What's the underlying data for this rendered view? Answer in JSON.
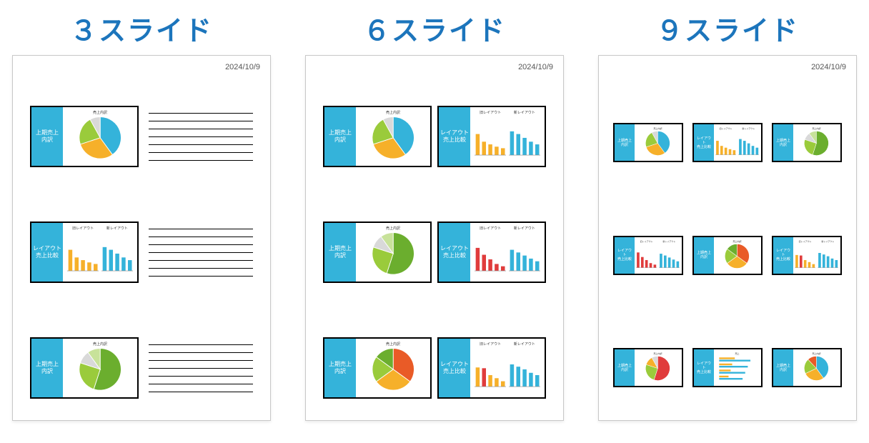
{
  "date": "2024/10/9",
  "layouts": {
    "three": {
      "title": "３スライド"
    },
    "six": {
      "title": "６スライド"
    },
    "nine": {
      "title": "９スライド"
    }
  },
  "slides": {
    "pie_a": {
      "sidebar": "上期売上\n内訳",
      "chart_title": "売上内訳",
      "type": "pie",
      "colors": [
        "#34B3DA",
        "#F6B02A",
        "#9ACB3B",
        "#D9D9D9"
      ],
      "values": [
        40,
        30,
        22,
        8
      ]
    },
    "bars_a": {
      "sidebar": "レイアウト\n売上比較",
      "type": "bars2",
      "left": {
        "title": "旧レイアウト",
        "values": [
          55,
          35,
          28,
          22,
          18
        ],
        "colors": [
          "#F6B02A",
          "#F6B02A",
          "#F6B02A",
          "#F6B02A",
          "#F6B02A"
        ]
      },
      "right": {
        "title": "新レイアウト",
        "values": [
          62,
          55,
          45,
          35,
          28
        ],
        "colors": [
          "#34B3DA",
          "#34B3DA",
          "#34B3DA",
          "#34B3DA",
          "#34B3DA"
        ]
      }
    },
    "pie_b": {
      "sidebar": "上期売上\n内訳",
      "chart_title": "売上内訳",
      "type": "pie",
      "colors": [
        "#6BAE2E",
        "#9ACB3B",
        "#D9D9D9",
        "#C8E29A"
      ],
      "values": [
        55,
        25,
        10,
        10
      ]
    },
    "pie_c": {
      "sidebar": "上期売上\n内訳",
      "chart_title": "売上内訳",
      "type": "pie",
      "colors": [
        "#E95B27",
        "#F6B02A",
        "#9ACB3B",
        "#6BAE2E"
      ],
      "values": [
        35,
        30,
        20,
        15
      ]
    },
    "bars_b": {
      "sidebar": "レイアウト\n売上比較",
      "type": "bars2",
      "left": {
        "title": "旧レイアウト",
        "values": [
          60,
          42,
          30,
          18,
          12
        ],
        "colors": [
          "#E03C3C",
          "#E03C3C",
          "#E03C3C",
          "#E03C3C",
          "#E03C3C"
        ]
      },
      "right": {
        "title": "新レイアウト",
        "values": [
          55,
          48,
          40,
          32,
          25
        ],
        "colors": [
          "#34B3DA",
          "#34B3DA",
          "#34B3DA",
          "#34B3DA",
          "#34B3DA"
        ]
      }
    },
    "bars_c": {
      "sidebar": "レイアウト\n売上比較",
      "type": "bars2",
      "left": {
        "title": "旧レイアウト",
        "values": [
          50,
          48,
          30,
          22,
          14
        ],
        "colors": [
          "#F6B02A",
          "#E03C3C",
          "#F6B02A",
          "#F6B02A",
          "#F6B02A"
        ]
      },
      "right": {
        "title": "新レイアウト",
        "values": [
          58,
          52,
          45,
          36,
          30
        ],
        "colors": [
          "#34B3DA",
          "#34B3DA",
          "#34B3DA",
          "#34B3DA",
          "#34B3DA"
        ]
      }
    },
    "pie_d": {
      "sidebar": "上期売上\n内訳",
      "chart_title": "売上内訳",
      "type": "pie",
      "colors": [
        "#E03C3C",
        "#9ACB3B",
        "#F6B02A",
        "#D9D9D9"
      ],
      "values": [
        55,
        25,
        12,
        8
      ]
    },
    "bars_h": {
      "sidebar": "レイアウト\n売上比較",
      "type": "hbars",
      "title": "売上",
      "rows": [
        {
          "a": 30,
          "b": 60
        },
        {
          "a": 25,
          "b": 55
        },
        {
          "a": 22,
          "b": 50
        },
        {
          "a": 18,
          "b": 45
        }
      ],
      "colors": {
        "a": "#F6B02A",
        "b": "#34B3DA"
      }
    },
    "pie_e": {
      "sidebar": "上期売上\n内訳",
      "chart_title": "売上内訳",
      "type": "pie",
      "colors": [
        "#34B3DA",
        "#F6B02A",
        "#9ACB3B",
        "#E95B27"
      ],
      "values": [
        40,
        28,
        20,
        12
      ]
    }
  },
  "arrangement": {
    "three": [
      "pie_a",
      "bars_a",
      "pie_b"
    ],
    "six": [
      [
        "pie_a",
        "bars_a"
      ],
      [
        "pie_b",
        "bars_b"
      ],
      [
        "pie_c",
        "bars_c"
      ]
    ],
    "nine": [
      [
        "pie_a",
        "bars_a",
        "pie_b"
      ],
      [
        "bars_b",
        "pie_c",
        "bars_c"
      ],
      [
        "pie_d",
        "bars_h",
        "pie_e"
      ]
    ]
  }
}
